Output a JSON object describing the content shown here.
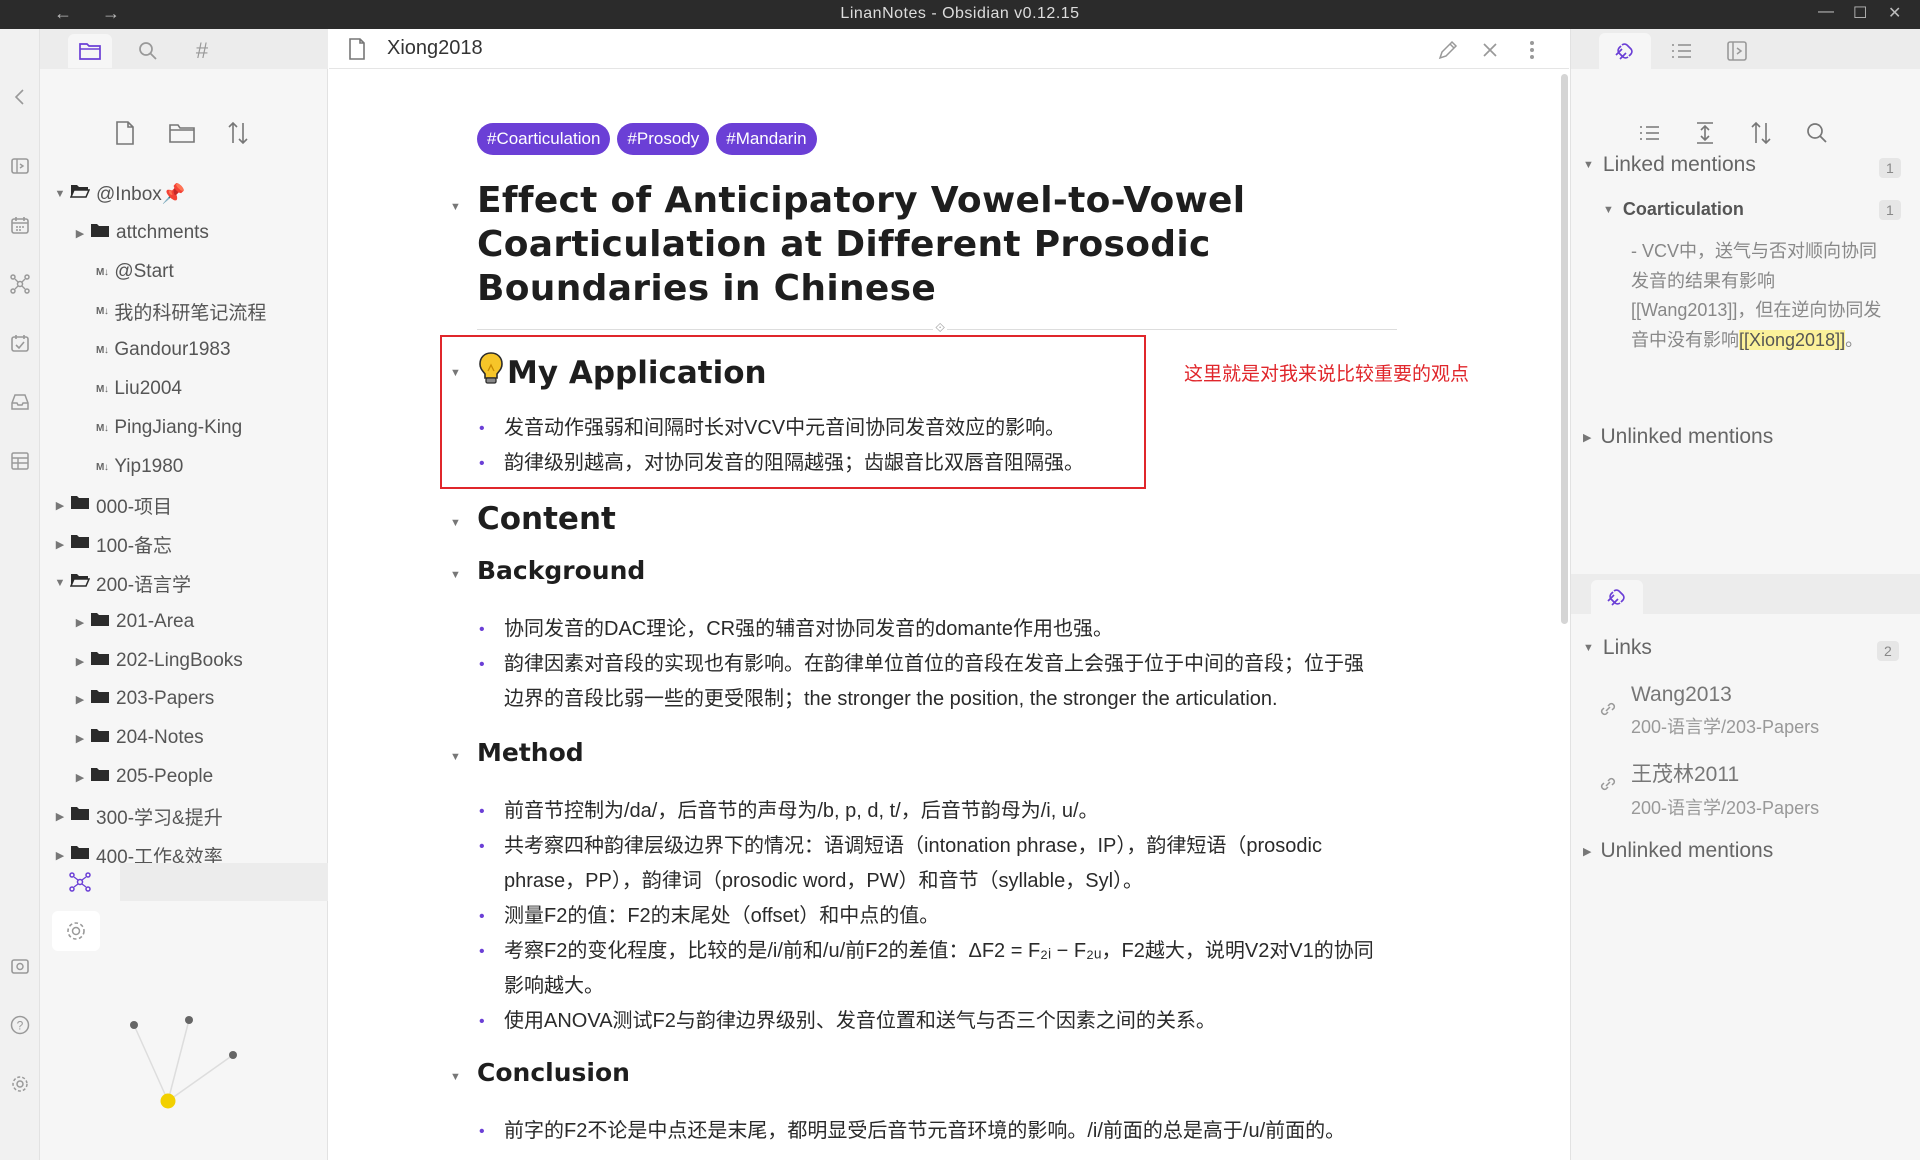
{
  "window": {
    "title": "LinanNotes - Obsidian v0.12.15"
  },
  "colors": {
    "accent": "#6b3fd6",
    "highlight_box": "#e0262b",
    "highlight_text_bg": "#fbf19a"
  },
  "file_explorer": {
    "items": [
      {
        "label": "@Inbox📌",
        "kind": "folder",
        "expanded": true
      },
      {
        "label": "attchments",
        "kind": "folder"
      },
      {
        "label": "@Start",
        "kind": "note"
      },
      {
        "label": "我的科研笔记流程",
        "kind": "note"
      },
      {
        "label": "Gandour1983",
        "kind": "note"
      },
      {
        "label": "Liu2004",
        "kind": "note"
      },
      {
        "label": "PingJiang-King",
        "kind": "note"
      },
      {
        "label": "Yip1980",
        "kind": "note"
      },
      {
        "label": "000-项目",
        "kind": "folder"
      },
      {
        "label": "100-备忘",
        "kind": "folder"
      },
      {
        "label": "200-语言学",
        "kind": "folder",
        "expanded": true
      },
      {
        "label": "201-Area",
        "kind": "folder"
      },
      {
        "label": "202-LingBooks",
        "kind": "folder"
      },
      {
        "label": "203-Papers",
        "kind": "folder"
      },
      {
        "label": "204-Notes",
        "kind": "folder"
      },
      {
        "label": "205-People",
        "kind": "folder"
      },
      {
        "label": "300-学习&提升",
        "kind": "folder"
      },
      {
        "label": "400-工作&效率",
        "kind": "folder"
      }
    ]
  },
  "editor": {
    "tab_title": "Xiong2018",
    "tags": [
      "#Coarticulation",
      "#Prosody",
      "#Mandarin"
    ],
    "title": "Effect of Anticipatory Vowel-to-Vowel Coarticulation at Different Prosodic Boundaries in Chinese",
    "application": {
      "heading": "My Application",
      "items": [
        "发音动作强弱和间隔时长对VCV中元音间协同发音效应的影响。",
        "韵律级别越高，对协同发音的阻隔越强；齿龈音比双唇音阻隔强。"
      ]
    },
    "red_note": "这里就是对我来说比较重要的观点",
    "content_heading": "Content",
    "background": {
      "heading": "Background",
      "items": [
        "协同发音的DAC理论，CR强的辅音对协同发音的domante作用也强。",
        "韵律因素对音段的实现也有影响。在韵律单位首位的音段在发音上会强于位于中间的音段；位于强边界的音段比弱一些的更受限制；the stronger the position, the stronger the articulation."
      ]
    },
    "method": {
      "heading": "Method",
      "items": [
        "前音节控制为/da/，后音节的声母为/b, p, d, t/，后音节韵母为/i, u/。",
        "共考察四种韵律层级边界下的情况：语调短语（intonation phrase，IP），韵律短语（prosodic phrase，PP），韵律词（prosodic word，PW）和音节（syllable，Syl）。",
        "测量F2的值：F2的末尾处（offset）和中点的值。",
        "考察F2的变化程度，比较的是/i/前和/u/前F2的差值：ΔF2 = F₂ᵢ − F₂ᵤ，F2越大，说明V2对V1的协同影响越大。",
        "使用ANOVA测试F2与韵律边界级别、发音位置和送气与否三个因素之间的关系。"
      ]
    },
    "conclusion": {
      "heading": "Conclusion",
      "items": [
        "前字的F2不论是中点还是末尾，都明显受后音节元音环境的影响。/i/前面的总是高于/u/前面的。"
      ]
    }
  },
  "backlinks": {
    "linked_mentions_label": "Linked mentions",
    "linked_count": "1",
    "source_label": "Coarticulation",
    "source_count": "1",
    "mention_text": "- VCV中，送气与否对顺向协同发音的结果有影响[[Wang2013]]，但在逆向协同发音中没有影响",
    "mention_highlight": "[[Xiong2018]]",
    "mention_tail": "。",
    "unlinked_label": "Unlinked mentions"
  },
  "outgoing": {
    "links_label": "Links",
    "links_count": "2",
    "links": [
      {
        "name": "Wang2013",
        "path": "200-语言学/203-Papers"
      },
      {
        "name": "王茂林2011",
        "path": "200-语言学/203-Papers"
      }
    ],
    "unlinked_label": "Unlinked mentions"
  }
}
